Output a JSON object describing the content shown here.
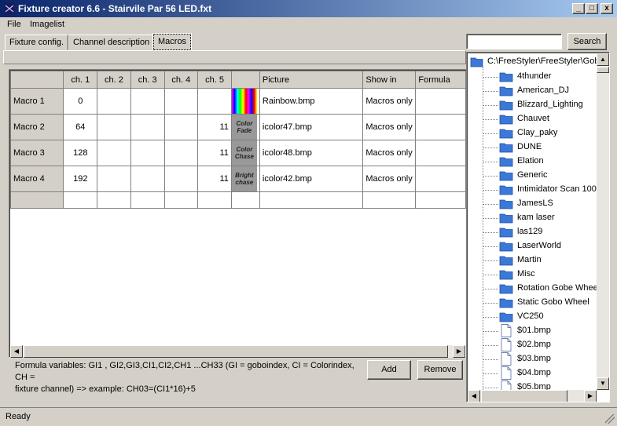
{
  "window": {
    "title": "Fixture creator 6.6 - Stairvile Par 56 LED.fxt",
    "minimize": "_",
    "maximize": "□",
    "close": "x"
  },
  "menu": [
    "File",
    "Imagelist"
  ],
  "tabs": [
    {
      "label": "Fixture config.",
      "active": false
    },
    {
      "label": "Channel description",
      "active": false
    },
    {
      "label": "Macros",
      "active": true
    }
  ],
  "search": {
    "value": "",
    "button_label": "Search"
  },
  "grid": {
    "headers": [
      "",
      "ch. 1",
      "ch. 2",
      "ch. 3",
      "ch. 4",
      "ch. 5",
      "",
      "Picture",
      "Show in",
      "Formula"
    ],
    "rows": [
      {
        "name": "Macro 1",
        "ch1": "0",
        "ch2": "",
        "ch3": "",
        "ch4": "",
        "ch5": "",
        "picture_text": "",
        "picture": "Rainbow.bmp",
        "show_in": "Macros only",
        "formula": ""
      },
      {
        "name": "Macro 2",
        "ch1": "64",
        "ch2": "",
        "ch3": "",
        "ch4": "",
        "ch5": "11",
        "picture_text": "Color Fade",
        "picture": "icolor47.bmp",
        "show_in": "Macros only",
        "formula": ""
      },
      {
        "name": "Macro 3",
        "ch1": "128",
        "ch2": "",
        "ch3": "",
        "ch4": "",
        "ch5": "11",
        "picture_text": "Color Chase",
        "picture": "icolor48.bmp",
        "show_in": "Macros only",
        "formula": ""
      },
      {
        "name": "Macro 4",
        "ch1": "192",
        "ch2": "",
        "ch3": "",
        "ch4": "",
        "ch5": "11",
        "picture_text": "Bright chase",
        "picture": "icolor42.bmp",
        "show_in": "Macros only",
        "formula": ""
      }
    ]
  },
  "formula_help": {
    "line1": "Formula variables: GI1 , GI2,GI3,CI1,CI2,CH1 ...CH33 (GI = goboindex, CI = Colorindex, CH =",
    "line2": "fixture channel)  => example: CH03=(CI1*16)+5"
  },
  "buttons": {
    "add": "Add",
    "remove": "Remove"
  },
  "tree": {
    "root": "C:\\FreeStyler\\FreeStyler\\Gob",
    "folders": [
      "4thunder",
      "American_DJ",
      "Blizzard_Lighting",
      "Chauvet",
      "Clay_paky",
      "DUNE",
      "Elation",
      "Generic",
      "Intimidator Scan 100",
      "JamesLS",
      "kam laser",
      "las129",
      "LaserWorld",
      "Martin",
      "Misc",
      "Rotation Gobe Wheel",
      "Static Gobo Wheel",
      "VC250"
    ],
    "files": [
      "$01.bmp",
      "$02.bmp",
      "$03.bmp",
      "$04.bmp",
      "$05.bmp"
    ]
  },
  "colors": {
    "folder": "#3c78d8",
    "title_start": "#0a246a",
    "title_end": "#a6caf0",
    "face": "#d4d0c8"
  },
  "status": {
    "text": "Ready"
  }
}
